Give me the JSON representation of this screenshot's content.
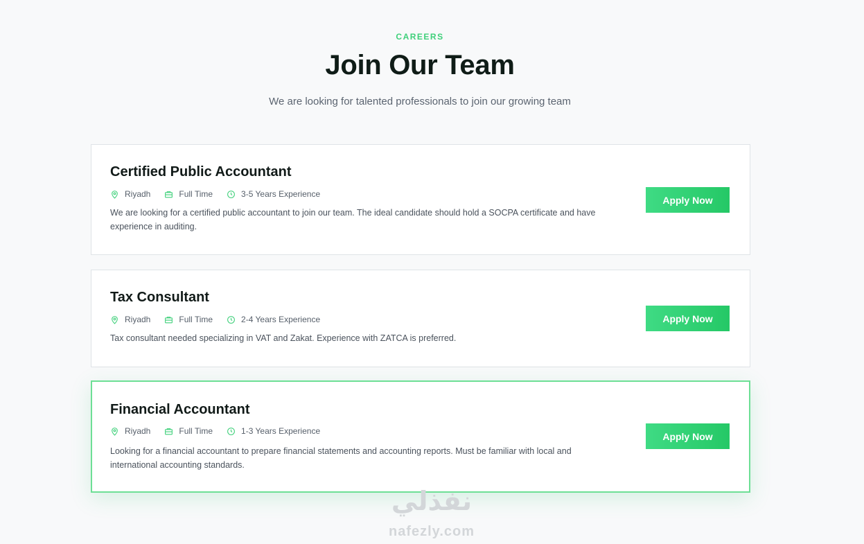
{
  "header": {
    "eyebrow": "CAREERS",
    "title": "Join Our Team",
    "subtitle": "We are looking for talented professionals to join our growing team"
  },
  "jobs": [
    {
      "title": "Certified Public Accountant",
      "location": "Riyadh",
      "type": "Full Time",
      "experience": "3-5 Years Experience",
      "description": "We are looking for a certified public accountant to join our team. The ideal candidate should hold a SOCPA certificate and have experience in auditing.",
      "apply_label": "Apply Now"
    },
    {
      "title": "Tax Consultant",
      "location": "Riyadh",
      "type": "Full Time",
      "experience": "2-4 Years Experience",
      "description": "Tax consultant needed specializing in VAT and Zakat. Experience with ZATCA is preferred.",
      "apply_label": "Apply Now"
    },
    {
      "title": "Financial Accountant",
      "location": "Riyadh",
      "type": "Full Time",
      "experience": "1-3 Years Experience",
      "description": "Looking for a financial accountant to prepare financial statements and accounting reports. Must be familiar with local and international accounting standards.",
      "apply_label": "Apply Now"
    }
  ],
  "watermark": {
    "arabic": "نفذلي",
    "latin": "nafezly.com"
  },
  "icons": {
    "location": "map-pin-icon",
    "type": "briefcase-icon",
    "experience": "clock-icon"
  },
  "colors": {
    "accent": "#3fd07a",
    "button": "#2ed573",
    "active_border": "#6ddf95"
  }
}
